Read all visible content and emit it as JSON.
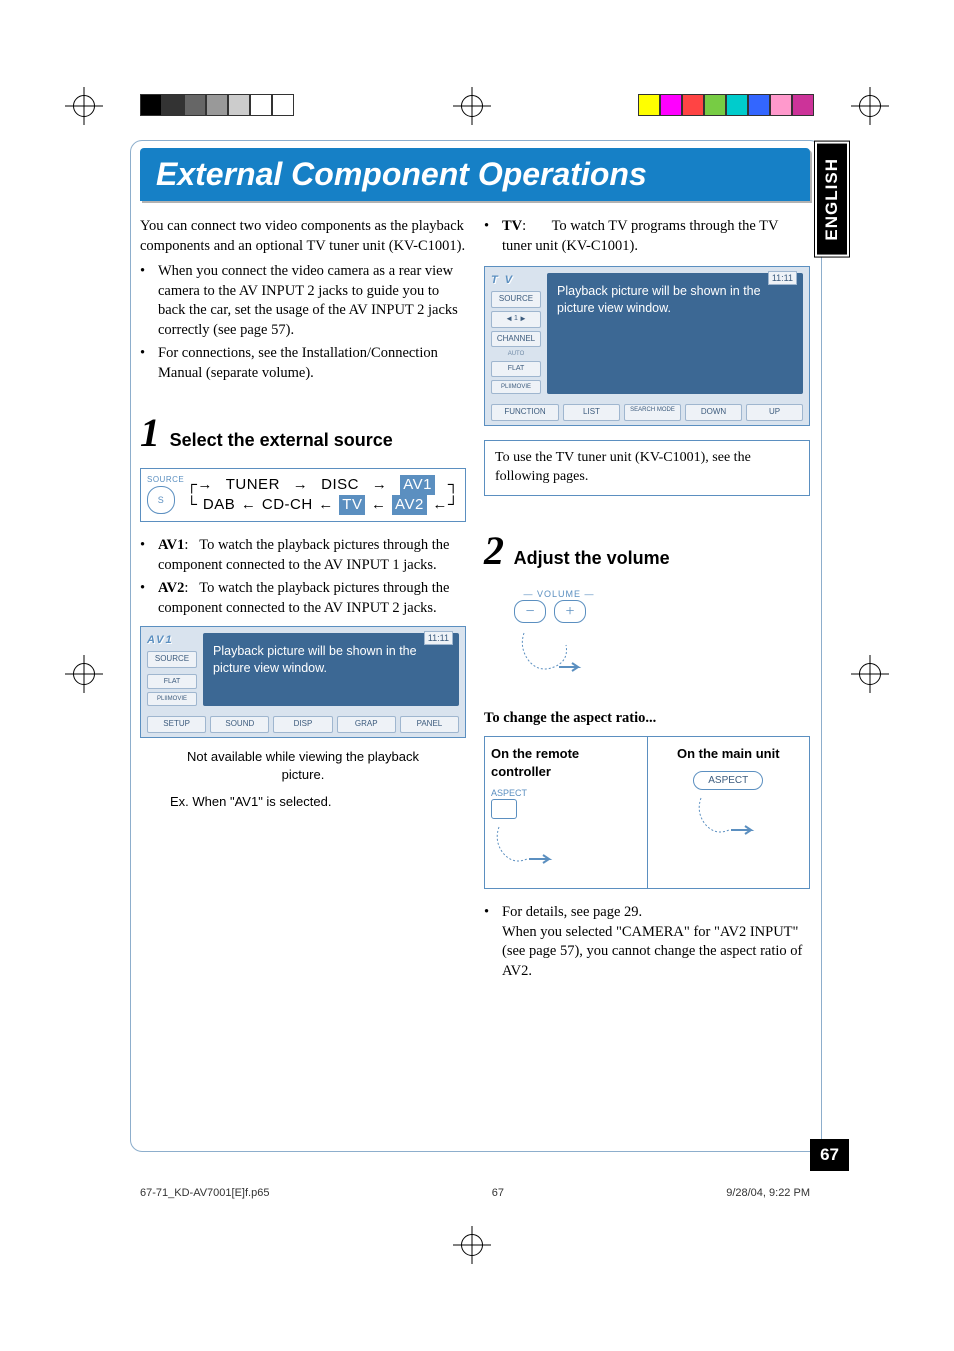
{
  "header": {
    "title": "External Component Operations"
  },
  "lang_tab": "ENGLISH",
  "page_number": "67",
  "intro": {
    "p1": "You can connect two video components as the playback components and an optional TV tuner unit (KV-C1001).",
    "b1": "When you connect the video camera as a rear view camera to the AV INPUT 2 jacks to guide you to back the car, set the usage of the AV INPUT 2 jacks correctly (see page 57).",
    "b2": "For connections, see the Installation/Connection Manual (separate volume)."
  },
  "step1": {
    "num": "1",
    "label": "Select the external source"
  },
  "source_chain": {
    "label": "SOURCE",
    "top": [
      "TUNER",
      "DISC",
      "AV1"
    ],
    "bot": [
      "DAB",
      "CD-CH",
      "TV",
      "AV2"
    ]
  },
  "defs": {
    "av1_label": "AV1",
    "av1_text": "To watch the playback pictures through the component connected to the AV INPUT 1 jacks.",
    "av2_label": "AV2",
    "av2_text": "To watch the playback pictures through the component connected to the AV INPUT 2 jacks.",
    "tv_label": "TV",
    "tv_text": "To watch TV programs through the TV tuner unit (KV-C1001)."
  },
  "ui_av1": {
    "title": "AV1",
    "source_btn": "SOURCE",
    "time": "11:11",
    "view_text": "Playback picture will be shown in the picture view window.",
    "left_flat": "FLAT",
    "left_plii": "PLIIMOVIE",
    "bottom": [
      "SETUP",
      "SOUND",
      "DISP",
      "GRAP",
      "PANEL"
    ],
    "caption1": "Not available while viewing the playback picture.",
    "caption2": "Ex. When \"AV1\" is selected."
  },
  "ui_tv": {
    "title": "T V",
    "source_btn": "SOURCE",
    "channel_btn": "CHANNEL",
    "auto_lbl": "AUTO",
    "left_flat": "FLAT",
    "left_plii": "PLIIMOVIE",
    "time": "11:11",
    "view_text": "Playback picture will be shown in the picture view window.",
    "function_btn": "FUNCTION",
    "bottom": [
      "LIST",
      "SEARCH MODE",
      "DOWN",
      "UP"
    ]
  },
  "note_box": "To use the TV tuner unit (KV-C1001), see the following pages.",
  "step2": {
    "num": "2",
    "label": "Adjust the volume"
  },
  "volume": {
    "label": "VOLUME",
    "minus": "−",
    "plus": "+"
  },
  "aspect": {
    "heading": "To change the aspect ratio...",
    "remote_hdr": "On the remote controller",
    "main_hdr": "On the main unit",
    "remote_btn": "ASPECT",
    "main_btn": "ASPECT",
    "foot_b": "For details, see page 29.",
    "foot_p": "When you selected \"CAMERA\" for \"AV2 INPUT\" (see page 57), you cannot change the aspect ratio of AV2."
  },
  "footer": {
    "file": "67-71_KD-AV7001[E]f.p65",
    "page": "67",
    "date": "9/28/04, 9:22 PM"
  },
  "colorbar_left": [
    "#000",
    "#333",
    "#666",
    "#999",
    "#ccc",
    "#fff",
    "#fff"
  ],
  "colorbar_right": [
    "#ff0",
    "#f0f",
    "#f44",
    "#7c4",
    "#0cc",
    "#36f",
    "#f9c",
    "#c39"
  ]
}
